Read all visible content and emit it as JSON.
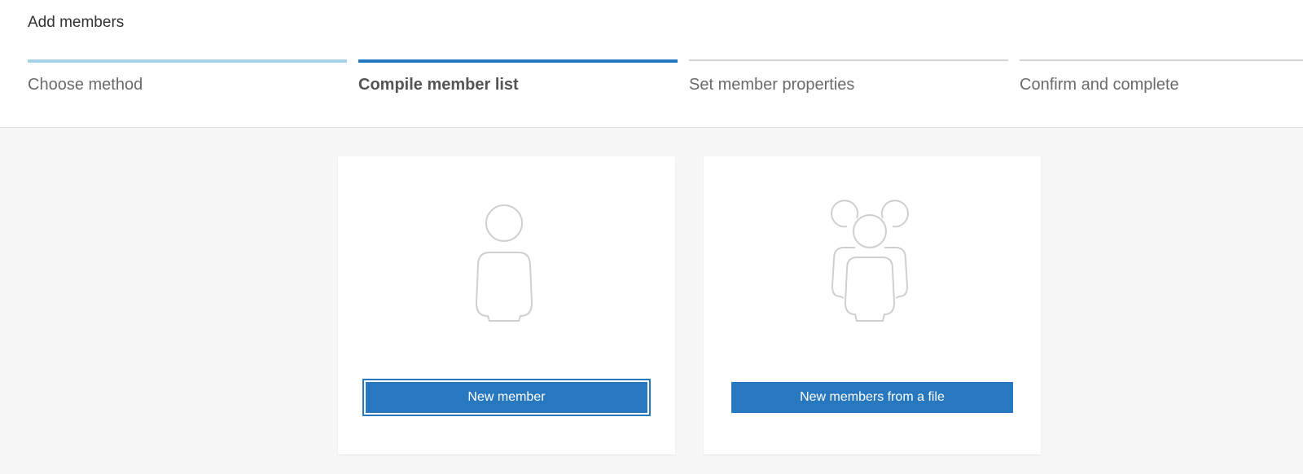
{
  "header": {
    "title": "Add members"
  },
  "steps": [
    {
      "label": "Choose method",
      "state": "done"
    },
    {
      "label": "Compile member list",
      "state": "active"
    },
    {
      "label": "Set member properties",
      "state": "pending"
    },
    {
      "label": "Confirm and complete",
      "state": "pending"
    }
  ],
  "cards": [
    {
      "icon": "single-person-icon",
      "button_label": "New member"
    },
    {
      "icon": "group-people-icon",
      "button_label": "New members from a file"
    }
  ],
  "colors": {
    "accent": "#2878c0",
    "step_done": "#a7d3ea",
    "step_pending": "#d4d4d4",
    "illustration_stroke": "#cfcfcf",
    "background": "#f7f7f7"
  }
}
